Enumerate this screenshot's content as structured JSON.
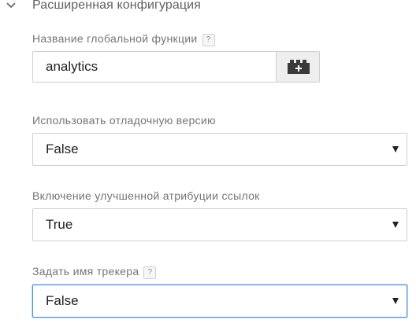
{
  "section": {
    "title": "Расширенная конфигурация",
    "chevron_icon": "chevron-down-icon"
  },
  "fields": {
    "global_function": {
      "label": "Название глобальной функции",
      "help": "?",
      "value": "analytics",
      "variable_button_icon": "variable-picker-icon"
    },
    "debug_version": {
      "label": "Использовать отладочную версию",
      "value": "False"
    },
    "enhanced_link_attribution": {
      "label": "Включение улучшенной атрибуции ссылок",
      "value": "True"
    },
    "tracker_name": {
      "label": "Задать имя трекера",
      "help": "?",
      "value": "False"
    }
  },
  "colors": {
    "focus_border": "#4a90e2",
    "border": "#cfcfcf",
    "label": "#757575"
  }
}
